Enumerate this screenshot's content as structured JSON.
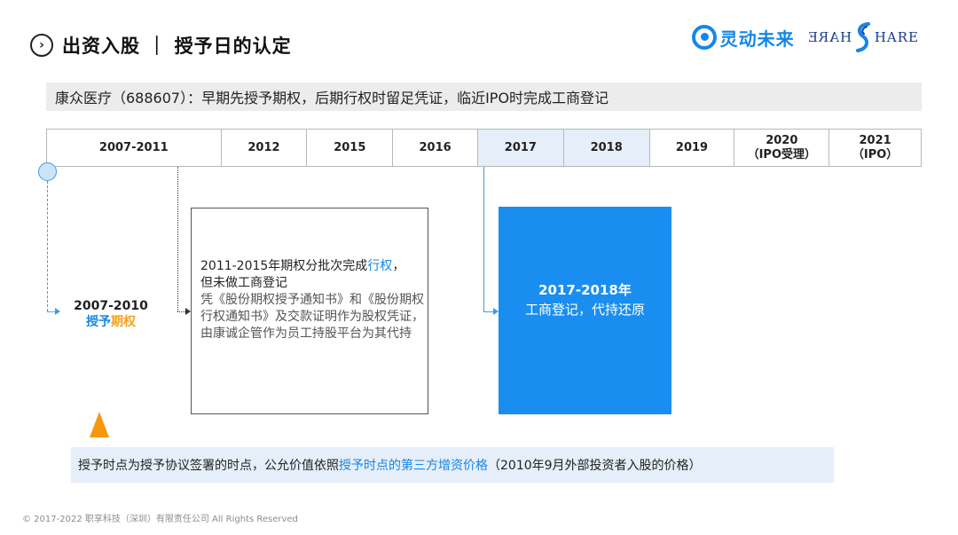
{
  "header": {
    "title_icon": "›",
    "title": "出资入股 ｜ 授予日的认定",
    "logo_cn": "灵动未来",
    "logo_share_left": "HARE",
    "logo_share_right": "HARE",
    "brand_color": "#1487e6"
  },
  "subtitle": "康众医疗（688607）：早期先授予期权，后期行权时留足凭证，临近IPO时完成工商登记",
  "timeline": [
    {
      "label": "2007-2011",
      "highlight": false
    },
    {
      "label": "2012",
      "highlight": false
    },
    {
      "label": "2015",
      "highlight": false
    },
    {
      "label": "2016",
      "highlight": false
    },
    {
      "label": "2017",
      "highlight": true
    },
    {
      "label": "2018",
      "highlight": true
    },
    {
      "label": "2019",
      "highlight": false
    },
    {
      "label": "2020\n（IPO受理）",
      "highlight": false
    },
    {
      "label": "2021\n（IPO）",
      "highlight": false
    }
  ],
  "left_label": {
    "years": "2007-2010",
    "part1": "授予",
    "part2": "期权"
  },
  "mid_box": {
    "line1_prefix": "2011-2015年期权分批次完成",
    "line1_highlight": "行权",
    "line1_suffix": "，",
    "line2": "但未做工商登记",
    "line3": "凭《股份期权授予通知书》和《股份期权行权通知书》及交款证明作为股权凭证，由康诚企管作为员工持股平台为其代持"
  },
  "blue_box": {
    "line1": "2017-2018年",
    "line2": "工商登记，代持还原"
  },
  "note": {
    "prefix": "授予时点为授予协议签署的时点，公允价值依照",
    "highlight": "授予时点的第三方增资价格",
    "suffix": "（2010年9月外部投资者入股的价格）"
  },
  "footer": "© 2017-2022 职享科技（深圳）有限责任公司 All Rights Reserved",
  "colors": {
    "accent_blue": "#1487e6",
    "accent_orange": "#f7960f",
    "highlight_bg": "#e6eef9",
    "box_blue": "#1a8ef0"
  }
}
